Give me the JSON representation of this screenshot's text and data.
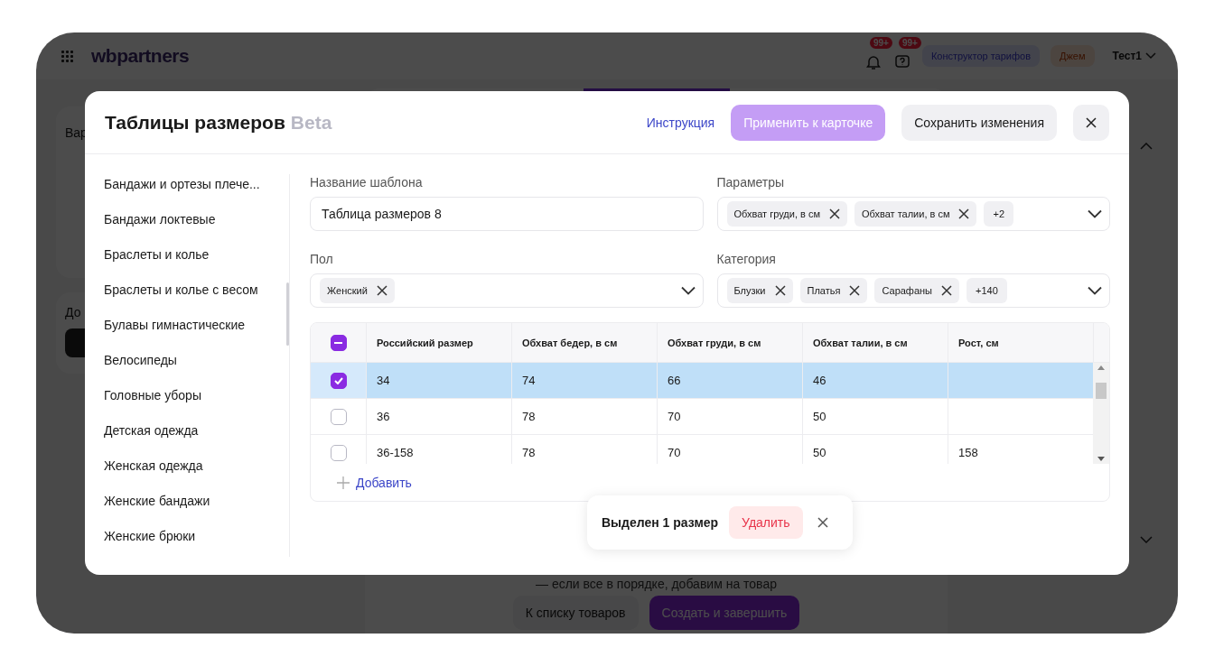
{
  "app": {
    "logo": "wbpartners",
    "notifications": [
      {
        "kind": "bell",
        "badge": "99+"
      },
      {
        "kind": "help",
        "badge": "99+"
      }
    ],
    "header_buttons": [
      {
        "kind": "tariff",
        "label": "Конструктор тарифов"
      },
      {
        "kind": "jam",
        "label": "Джем"
      }
    ],
    "user": "Тест1",
    "left_fragments": [
      "Вар",
      "До"
    ],
    "note": "— если все в порядке, добавим на товар",
    "buttons": [
      {
        "kind": "secondary",
        "label": "К списку товаров"
      },
      {
        "kind": "primary",
        "label": "Создать и завершить"
      }
    ]
  },
  "modal": {
    "title": "Таблицы размеров",
    "badge": "Beta",
    "instruction_link": "Инструкция",
    "apply_button": {
      "label": "Применить к карточке",
      "disabled": true
    },
    "save_button": "Сохранить изменения",
    "categories": [
      "Бандажи и ортезы плече...",
      "Бандажи локтевые",
      "Браслеты и колье",
      "Браслеты и колье с весом",
      "Булавы гимнастические",
      "Велосипеды",
      "Головные уборы",
      "Детская одежда",
      "Женская одежда",
      "Женские бандажи",
      "Женские брюки"
    ],
    "template_name": {
      "label": "Название шаблона",
      "value": "Таблица размеров 8"
    },
    "parameters": {
      "label": "Параметры",
      "tags": [
        "Обхват груди, в см",
        "Обхват талии, в см"
      ],
      "more": "+2"
    },
    "gender": {
      "label": "Пол",
      "tags": [
        "Женский"
      ]
    },
    "category": {
      "label": "Категория",
      "tags": [
        "Блузки",
        "Платья",
        "Сарафаны"
      ],
      "more": "+140"
    },
    "table": {
      "select_all_checked": true,
      "select_all_partial": true,
      "columns": [
        "Российский размер",
        "Обхват бедер, в см",
        "Обхват груди, в см",
        "Обхват талии, в см",
        "Рост, см"
      ],
      "rows": [
        {
          "selected": true,
          "cells": [
            "34",
            "74",
            "66",
            "46",
            ""
          ]
        },
        {
          "selected": false,
          "cells": [
            "36",
            "78",
            "70",
            "50",
            ""
          ]
        },
        {
          "selected": false,
          "cells": [
            "36-158",
            "78",
            "70",
            "50",
            "158"
          ]
        }
      ]
    },
    "add_button": "Добавить",
    "selection_bar": {
      "text": "Выделен 1 размер",
      "delete_button": "Удалить"
    }
  }
}
